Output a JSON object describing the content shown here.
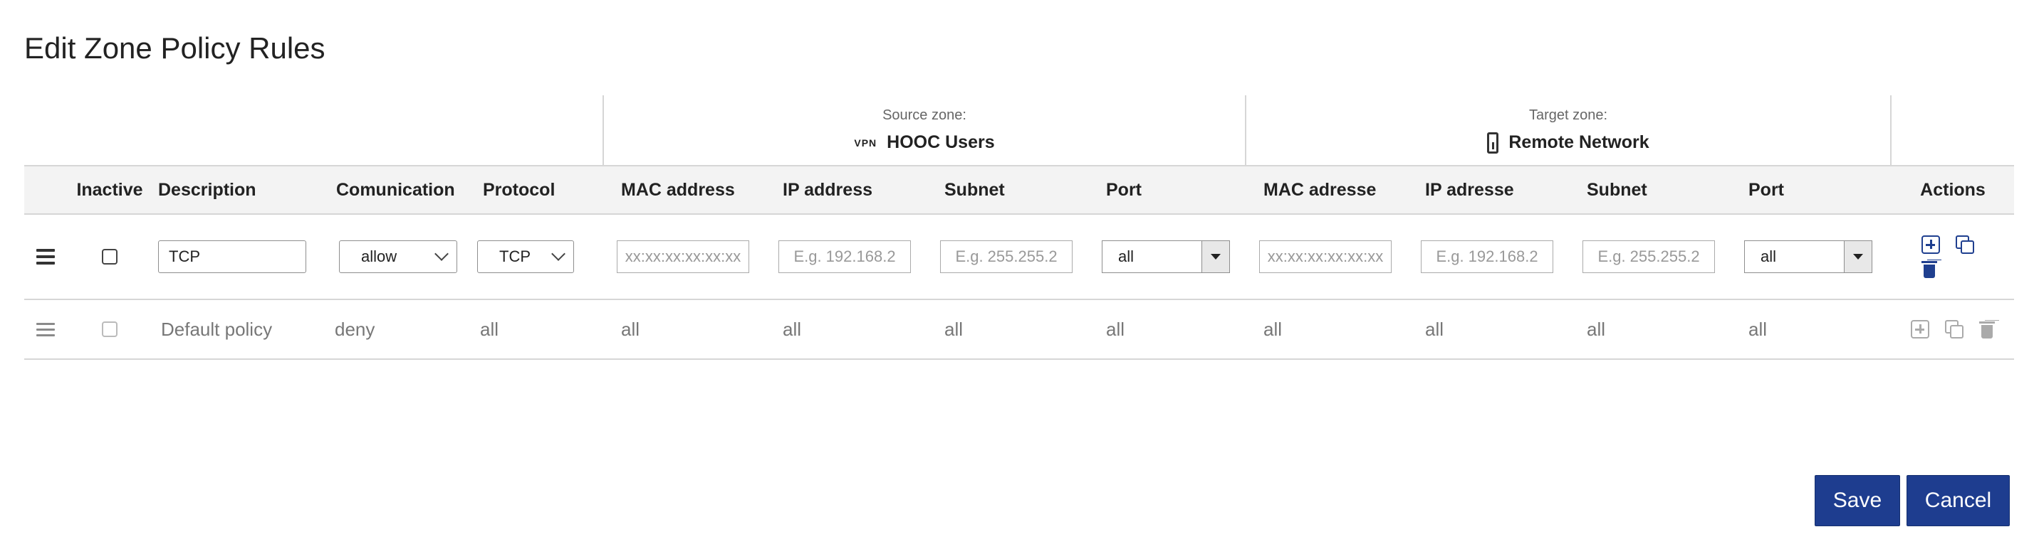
{
  "page": {
    "title": "Edit Zone Policy Rules"
  },
  "source_zone": {
    "label": "Source zone:",
    "tag": "VPN",
    "name": "HOOC Users"
  },
  "target_zone": {
    "label": "Target zone:",
    "icon": "device-icon",
    "name": "Remote Network"
  },
  "columns": [
    "Inactive",
    "Description",
    "Comunication",
    "Protocol",
    "MAC address",
    "IP address",
    "Subnet",
    "Port",
    "MAC adresse",
    "IP adresse",
    "Subnet",
    "Port",
    "Actions"
  ],
  "edit_row": {
    "description": "TCP",
    "comunication": "allow",
    "protocol": "TCP",
    "src_mac_placeholder": "xx:xx:xx:xx:xx:xx",
    "src_ip_placeholder": "E.g. 192.168.2",
    "src_subnet_placeholder": "E.g. 255.255.2",
    "src_port": "all",
    "tgt_mac_placeholder": "xx:xx:xx:xx:xx:xx",
    "tgt_ip_placeholder": "E.g. 192.168.2",
    "tgt_subnet_placeholder": "E.g. 255.255.2",
    "tgt_port": "all"
  },
  "default_row": {
    "description": "Default policy",
    "comunication": "deny",
    "protocol": "all",
    "src_mac": "all",
    "src_ip": "all",
    "src_subnet": "all",
    "src_port": "all",
    "tgt_mac": "all",
    "tgt_ip": "all",
    "tgt_subnet": "all",
    "tgt_port": "all"
  },
  "buttons": {
    "save": "Save",
    "cancel": "Cancel"
  },
  "colors": {
    "primary": "#1e3d8f",
    "header_bg": "#f3f3f3",
    "border": "#d6d6d6"
  }
}
